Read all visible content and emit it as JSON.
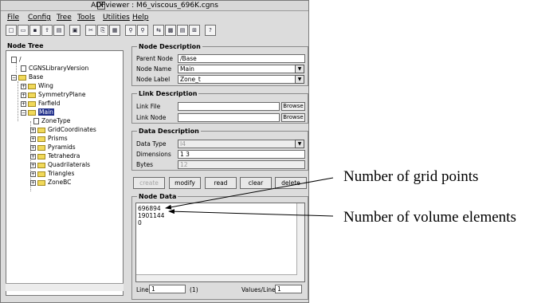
{
  "window": {
    "title": "ADFviewer : M6_viscous_696K.cgns",
    "title_icon": "X"
  },
  "menu": [
    "File",
    "Config",
    "Tree",
    "Tools",
    "Utilities",
    "Help"
  ],
  "toolbar_icons": [
    "new-file-icon",
    "open-folder-icon",
    "save-icon",
    "export-icon",
    "print-icon",
    "image-icon",
    "cut-icon",
    "copy-icon",
    "paste-icon",
    "find-icon",
    "find-next-icon",
    "link-icon",
    "graph-icon",
    "properties-icon",
    "info-icon",
    "help-icon"
  ],
  "toolbar_glyphs": [
    "□",
    "▭",
    "▪",
    "⇪",
    "▤",
    "▣",
    "✂",
    "⎘",
    "▦",
    "⚲",
    "⚲",
    "⇆",
    "▩",
    "▤",
    "⊞",
    "?"
  ],
  "tree": {
    "label": "Node Tree",
    "nodes": [
      {
        "text": "/",
        "kind": "doc"
      },
      {
        "text": "CGNSLibraryVersion",
        "kind": "doc"
      },
      {
        "text": "Base",
        "kind": "folder",
        "pm": "−"
      },
      {
        "text": "Wing",
        "kind": "folder",
        "pm": "+"
      },
      {
        "text": "SymmetryPlane",
        "kind": "folder",
        "pm": "+"
      },
      {
        "text": "Farfield",
        "kind": "folder",
        "pm": "+"
      },
      {
        "text": "Main",
        "kind": "folder",
        "pm": "−",
        "selected": true
      },
      {
        "text": "ZoneType",
        "kind": "doc"
      },
      {
        "text": "GridCoordinates",
        "kind": "folder",
        "pm": "+"
      },
      {
        "text": "Prisms",
        "kind": "folder",
        "pm": "+"
      },
      {
        "text": "Pyramids",
        "kind": "folder",
        "pm": "+"
      },
      {
        "text": "Tetrahedra",
        "kind": "folder",
        "pm": "+"
      },
      {
        "text": "Quadrilaterals",
        "kind": "folder",
        "pm": "+"
      },
      {
        "text": "Triangles",
        "kind": "folder",
        "pm": "+"
      },
      {
        "text": "ZoneBC",
        "kind": "folder",
        "pm": "+"
      }
    ]
  },
  "node_description": {
    "title": "Node Description",
    "parent_node_label": "Parent Node",
    "parent_node_value": "/Base",
    "node_name_label": "Node Name",
    "node_name_value": "Main",
    "node_label_label": "Node Label",
    "node_label_value": "Zone_t"
  },
  "link_description": {
    "title": "Link Description",
    "link_file_label": "Link File",
    "link_file_value": "",
    "link_node_label": "Link Node",
    "link_node_value": "",
    "browse_label": "Browse"
  },
  "data_description": {
    "title": "Data Description",
    "data_type_label": "Data Type",
    "data_type_value": "I4",
    "dimensions_label": "Dimensions",
    "dimensions_value": "1 3",
    "bytes_label": "Bytes",
    "bytes_value": "12"
  },
  "actions": {
    "create": "create",
    "modify": "modify",
    "read": "read",
    "clear": "clear",
    "delete": "delete"
  },
  "node_data": {
    "title": "Node Data",
    "lines": [
      "696894",
      "1901144",
      "0"
    ],
    "line_label": "Line",
    "line_value": "1",
    "line_count": "(1)",
    "values_per_line_label": "Values/Line",
    "values_per_line_value": "1"
  },
  "annotations": {
    "grid_points": "Number of grid points",
    "volume_elements": "Number of volume elements"
  },
  "colors": {
    "selection": "#1f2e8a",
    "window_bg": "#dcdcdc",
    "folder": "#f1d95a"
  }
}
